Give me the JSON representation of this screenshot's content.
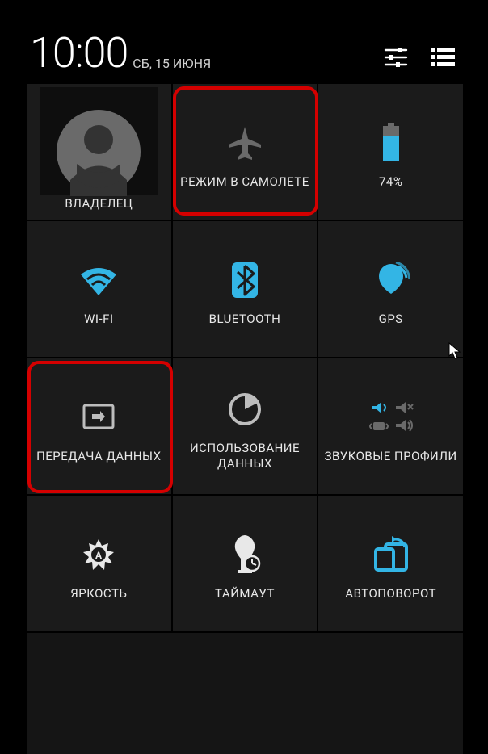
{
  "status": {
    "time": "10:00",
    "date": "СБ, 15 ИЮНЯ"
  },
  "tiles": {
    "owner": {
      "label": "ВЛАДЕЛЕЦ"
    },
    "airplane": {
      "label": "РЕЖИМ В САМОЛЕТЕ"
    },
    "battery": {
      "label": "74%"
    },
    "wifi": {
      "label": "WI-FI"
    },
    "bluetooth": {
      "label": "BLUETOOTH"
    },
    "gps": {
      "label": "GPS"
    },
    "data": {
      "label": "ПЕРЕДАЧА ДАННЫХ"
    },
    "datausage": {
      "label": "ИСПОЛЬЗОВАНИЕ ДАННЫХ"
    },
    "sound": {
      "label": "ЗВУКОВЫЕ ПРОФИЛИ"
    },
    "brightness": {
      "label": "ЯРКОСТЬ"
    },
    "timeout": {
      "label": "ТАЙМАУТ"
    },
    "autorotate": {
      "label": "АВТОПОВОРОТ"
    }
  },
  "colors": {
    "accent": "#33b5e5",
    "dim": "#6a6a6a",
    "highlight": "#d40000"
  }
}
